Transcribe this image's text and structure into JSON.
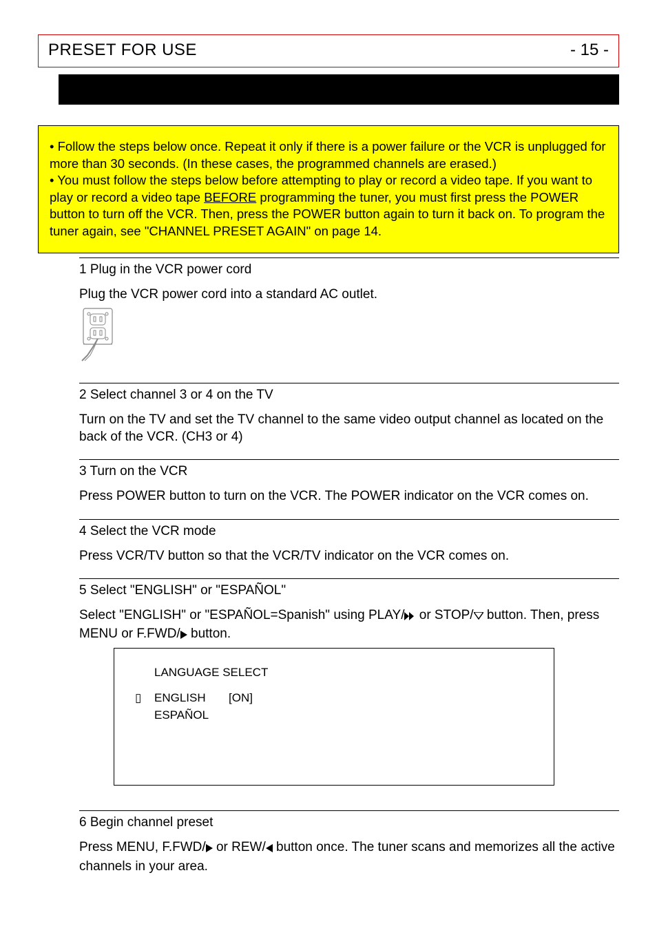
{
  "header": {
    "title": "PRESET FOR USE",
    "page_number": "- 15 -"
  },
  "notice": {
    "line1_prefix": "• Follow the steps below once. Repeat it only if there is a power failure or the VCR is unplugged for more than 30 seconds. (In these cases, the programmed channels are erased.)",
    "line2_a": "• You must follow the steps below before attempting to play or record a video tape. If you want to play or record a video tape ",
    "line2_before_word": "BEFORE",
    "line2_b": " programming the tuner, you must first press the POWER button to turn off the VCR. Then, press the POWER button again to turn it back on. To program the tuner again, see \"CHANNEL PRESET AGAIN\" on page 14."
  },
  "steps": {
    "s1_title": "1 Plug in the VCR power cord",
    "s1_body": "Plug the VCR power cord into a standard AC outlet.",
    "s2_title": "2 Select channel 3 or 4 on the TV",
    "s2_body": "Turn on the TV and set the TV channel to the same video output channel as located on the back of the VCR. (CH3 or 4)",
    "s3_title": "3 Turn on the VCR",
    "s3_body": "Press POWER button to turn on the VCR. The POWER indicator on the VCR comes on.",
    "s4_title": "4 Select the VCR mode",
    "s4_body": "Press VCR/TV button so that the VCR/TV indicator on the VCR comes on.",
    "s5_title": "5 Select \"ENGLISH\" or \"ESPAÑOL\"",
    "s5_body_a": "Select \"ENGLISH\" or \"ESPAÑOL=Spanish\" using PLAY/",
    "s5_body_b": " or STOP/",
    "s5_body_c": " button. Then, press MENU or F.FWD/",
    "s5_body_d": " button.",
    "s6_title": "6 Begin channel preset",
    "s6_body_a": "Press MENU, F.FWD/",
    "s6_body_b": " or REW/",
    "s6_body_c": " button once. The tuner scans and memorizes all the active channels in your area."
  },
  "screen": {
    "title": "LANGUAGE SELECT",
    "selector_glyph": "▯",
    "item1": "ENGLISH",
    "item1_state": "[ON]",
    "item2": "ESPAÑOL"
  }
}
